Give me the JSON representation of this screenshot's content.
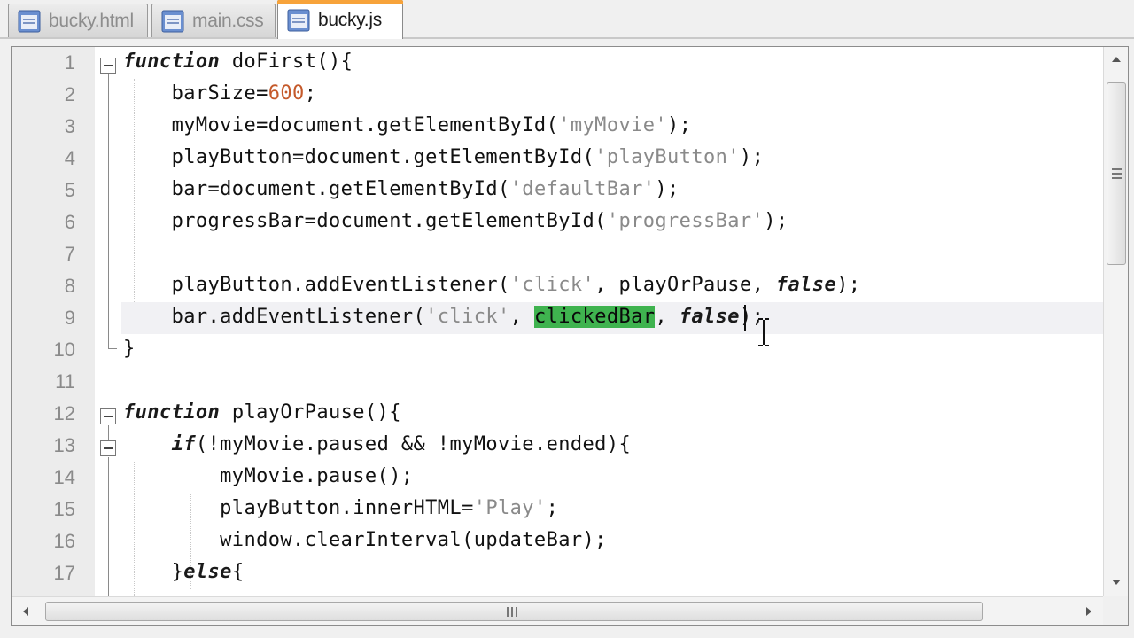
{
  "tabs": [
    {
      "label": "bucky.html",
      "icon": "file-icon",
      "active": false
    },
    {
      "label": "main.css",
      "icon": "file-icon",
      "active": false
    },
    {
      "label": "bucky.js",
      "icon": "file-icon",
      "active": true
    }
  ],
  "editor": {
    "lines": [
      {
        "n": "1"
      },
      {
        "n": "2"
      },
      {
        "n": "3"
      },
      {
        "n": "4"
      },
      {
        "n": "5"
      },
      {
        "n": "6"
      },
      {
        "n": "7"
      },
      {
        "n": "8"
      },
      {
        "n": "9"
      },
      {
        "n": "10"
      },
      {
        "n": "11"
      },
      {
        "n": "12"
      },
      {
        "n": "13"
      },
      {
        "n": "14"
      },
      {
        "n": "15"
      },
      {
        "n": "16"
      },
      {
        "n": "17"
      }
    ],
    "code": {
      "l1_kw": "function",
      "l1_rest": " doFirst(){",
      "l2_a": "    barSize=",
      "l2_num": "600",
      "l2_b": ";",
      "l3_a": "    myMovie=document.getElementById(",
      "l3_str": "'myMovie'",
      "l3_b": ");",
      "l4_a": "    playButton=document.getElementById(",
      "l4_str": "'playButton'",
      "l4_b": ");",
      "l5_a": "    bar=document.getElementById(",
      "l5_str": "'defaultBar'",
      "l5_b": ");",
      "l6_a": "    progressBar=document.getElementById(",
      "l6_str": "'progressBar'",
      "l6_b": ");",
      "l8_a": "    playButton.addEventListener(",
      "l8_str": "'click'",
      "l8_b": ", playOrPause, ",
      "l8_kw": "false",
      "l8_c": ");",
      "l9_a": "    bar.addEventListener(",
      "l9_str": "'click'",
      "l9_b": ", ",
      "l9_sel": "clickedBar",
      "l9_c": ", ",
      "l9_kw": "false",
      "l9_d": ");",
      "l10": "}",
      "l12_kw": "function",
      "l12_rest": " playOrPause(){",
      "l13_pre": "    ",
      "l13_kw": "if",
      "l13_rest": "(!myMovie.paused && !myMovie.ended){",
      "l14": "        myMovie.pause();",
      "l15_a": "        playButton.innerHTML=",
      "l15_str": "'Play'",
      "l15_b": ";",
      "l16": "        window.clearInterval(updateBar);",
      "l17_a": "    }",
      "l17_kw": "else",
      "l17_b": "{"
    }
  },
  "colors": {
    "active_tab_accent": "#f7a33a",
    "selection": "#3fb34f",
    "string": "#8a8a8a",
    "number": "#c55a2b"
  }
}
